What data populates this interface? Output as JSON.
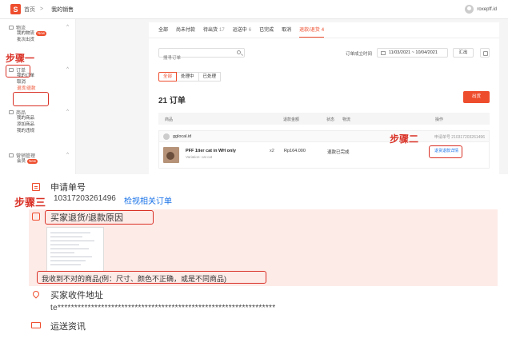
{
  "header": {
    "home_label": "首页",
    "separator": ">",
    "current_page": "我的销售",
    "username": "roxepff.id"
  },
  "sidebar": {
    "sections": [
      {
        "title": "物流",
        "items": [
          {
            "label": "我的物流",
            "badge": "New"
          },
          {
            "label": "批次出货"
          }
        ]
      },
      {
        "title": "订单",
        "items": [
          {
            "label": "我的订单"
          },
          {
            "label": "取消"
          },
          {
            "label": "退货/退款",
            "active": true
          }
        ]
      },
      {
        "title": "商品",
        "items": [
          {
            "label": "我的商品"
          },
          {
            "label": "添加商品"
          },
          {
            "label": "我的违规"
          }
        ]
      },
      {
        "title": "营销管理",
        "items": [
          {
            "label": "会员",
            "badge": "New"
          }
        ]
      }
    ]
  },
  "annotations": {
    "step1": "步骤一",
    "step2": "步骤二",
    "step3": "步骤三"
  },
  "tabs": [
    {
      "label": "全部",
      "count": ""
    },
    {
      "label": "尚未付款",
      "count": ""
    },
    {
      "label": "待出货",
      "count": "17"
    },
    {
      "label": "运送中",
      "count": "6"
    },
    {
      "label": "已完成",
      "count": ""
    },
    {
      "label": "取消",
      "count": ""
    },
    {
      "label": "退款/退货",
      "count": "4",
      "active": true
    }
  ],
  "filters": {
    "search_placeholder": "搜寻订单",
    "date_label": "订单成立时间",
    "date_range": "11/03/2021 ~ 10/04/2021",
    "export_label": "汇出"
  },
  "subtabs": [
    "全部",
    "处理中",
    "已处理"
  ],
  "order_count": "21 订单",
  "ship_button": "出货",
  "table": {
    "headers": [
      "商品",
      "退款金额",
      "状态",
      "物流",
      "操作"
    ],
    "buyer": "gglocal.id",
    "request_no": "申请单号 210317203261496",
    "product_name": "PFF 1tier cat in WH only",
    "product_variation": "Variation: cat cat",
    "quantity": "x2",
    "refund_amount": "Rp164.000",
    "status": "退款已完成",
    "detail_link": "退货退款详情"
  },
  "detail": {
    "request_label": "申请单号",
    "request_no": "10317203261496",
    "view_order_link": "检视相关订单",
    "reason_label": "买家退货/退款原因",
    "reason_text": "我收到不对的商品(例：尺寸、颜色不正确，或是不同商品)",
    "address_label": "买家收件地址",
    "address_value": "te*****************************************************************",
    "shipping_label": "运送资讯"
  },
  "colors": {
    "brand": "#ee4d2d",
    "annotation": "#d93025",
    "link": "#1a73e8",
    "reason_bg": "#fdebe8"
  }
}
